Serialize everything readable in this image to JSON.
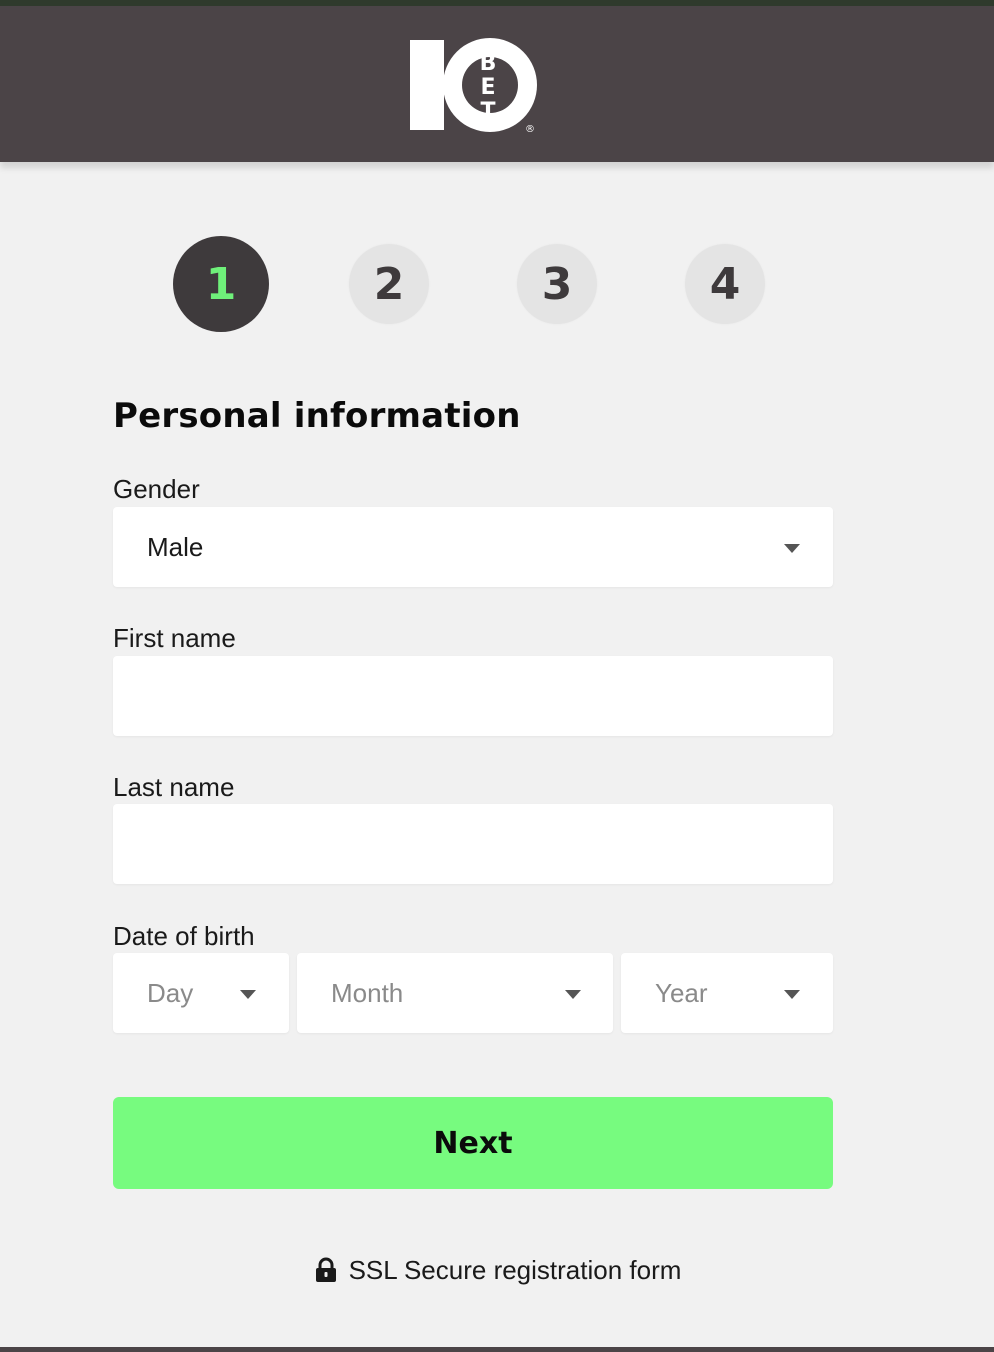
{
  "header": {
    "logo": {
      "numeral": "10",
      "letters": [
        "B",
        "E",
        "T"
      ],
      "registered": "®"
    }
  },
  "steps": [
    {
      "label": "1",
      "active": true
    },
    {
      "label": "2",
      "active": false
    },
    {
      "label": "3",
      "active": false
    },
    {
      "label": "4",
      "active": false
    }
  ],
  "form": {
    "title": "Personal information",
    "gender": {
      "label": "Gender",
      "value": "Male"
    },
    "first_name": {
      "label": "First name",
      "value": "",
      "placeholder": ""
    },
    "last_name": {
      "label": "Last name",
      "value": "",
      "placeholder": ""
    },
    "dob": {
      "label": "Date of birth",
      "day_placeholder": "Day",
      "month_placeholder": "Month",
      "year_placeholder": "Year"
    },
    "next_label": "Next",
    "ssl_text": "SSL Secure registration form"
  },
  "colors": {
    "header_bg": "#4b4447",
    "accent_green": "#77fb7f",
    "active_step_number": "#6ff07a",
    "page_bg": "#f1f1f1"
  }
}
